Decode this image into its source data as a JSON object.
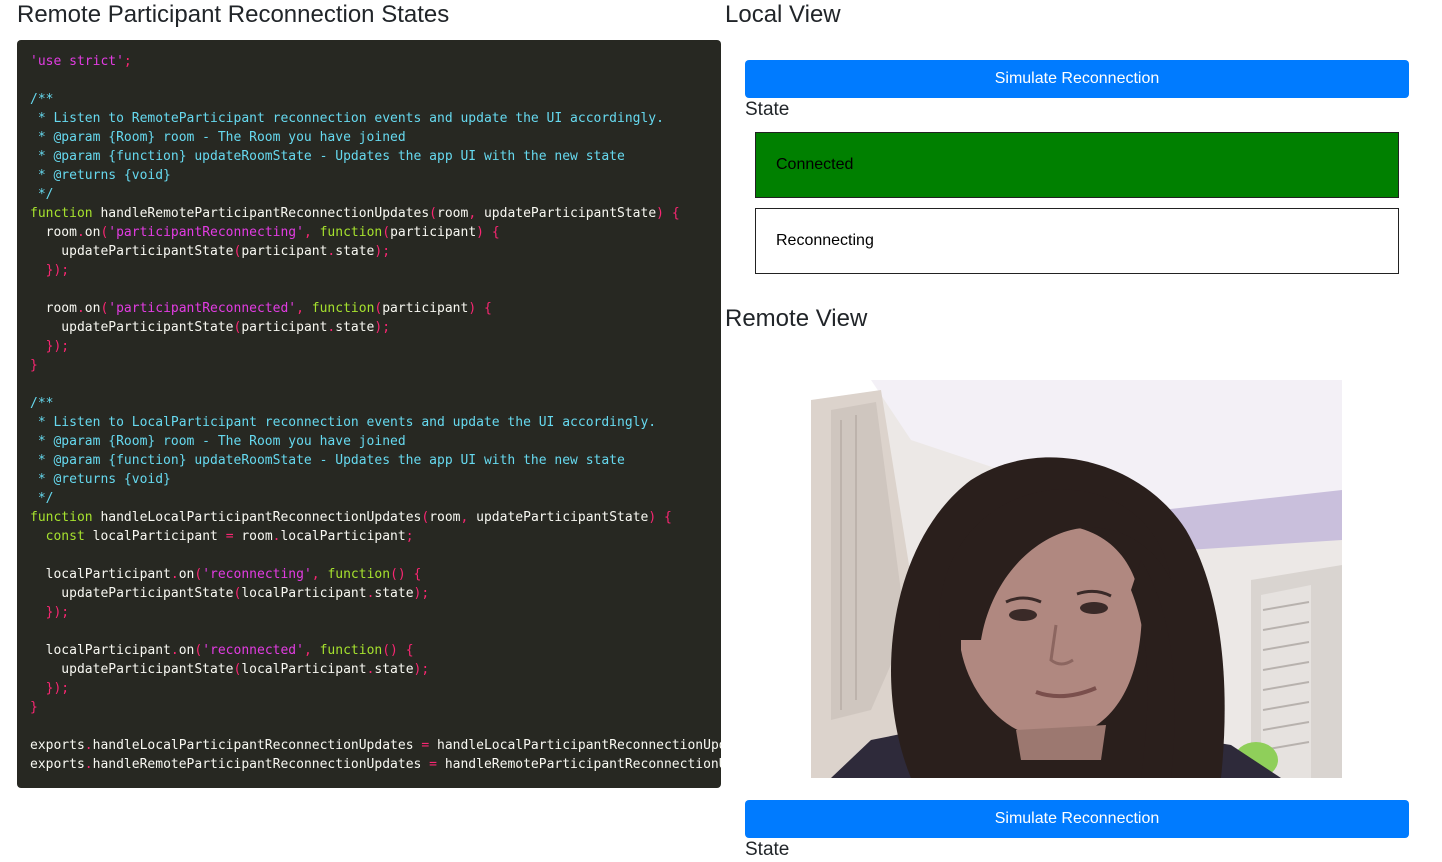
{
  "left_panel": {
    "title": "Remote Participant Reconnection States",
    "code_lines": [
      [
        [
          "s",
          "'use strict'"
        ],
        [
          "p",
          ";"
        ]
      ],
      [],
      [
        [
          "c",
          "/**"
        ]
      ],
      [
        [
          "c",
          " * Listen to RemoteParticipant reconnection events and update the UI accordingly."
        ]
      ],
      [
        [
          "c",
          " * @param {Room} room - The Room you have joined"
        ]
      ],
      [
        [
          "c",
          " * @param {function} updateRoomState - Updates the app UI with the new state"
        ]
      ],
      [
        [
          "c",
          " * @returns {void}"
        ]
      ],
      [
        [
          "c",
          " */"
        ]
      ],
      [
        [
          "k",
          "function"
        ],
        [
          "v",
          " handleRemoteParticipantReconnectionUpdates"
        ],
        [
          "p",
          "("
        ],
        [
          "v",
          "room"
        ],
        [
          "p",
          ","
        ],
        [
          "v",
          " updateParticipantState"
        ],
        [
          "p",
          ")"
        ],
        [
          "v",
          " "
        ],
        [
          "p",
          "{"
        ]
      ],
      [
        [
          "v",
          "  room"
        ],
        [
          "p",
          "."
        ],
        [
          "v",
          "on"
        ],
        [
          "p",
          "("
        ],
        [
          "s",
          "'participantReconnecting'"
        ],
        [
          "p",
          ","
        ],
        [
          "v",
          " "
        ],
        [
          "k",
          "function"
        ],
        [
          "p",
          "("
        ],
        [
          "v",
          "participant"
        ],
        [
          "p",
          ")"
        ],
        [
          "v",
          " "
        ],
        [
          "p",
          "{"
        ]
      ],
      [
        [
          "v",
          "    updateParticipantState"
        ],
        [
          "p",
          "("
        ],
        [
          "v",
          "participant"
        ],
        [
          "p",
          "."
        ],
        [
          "v",
          "state"
        ],
        [
          "p",
          ");"
        ]
      ],
      [
        [
          "p",
          "  });"
        ]
      ],
      [],
      [
        [
          "v",
          "  room"
        ],
        [
          "p",
          "."
        ],
        [
          "v",
          "on"
        ],
        [
          "p",
          "("
        ],
        [
          "s",
          "'participantReconnected'"
        ],
        [
          "p",
          ","
        ],
        [
          "v",
          " "
        ],
        [
          "k",
          "function"
        ],
        [
          "p",
          "("
        ],
        [
          "v",
          "participant"
        ],
        [
          "p",
          ")"
        ],
        [
          "v",
          " "
        ],
        [
          "p",
          "{"
        ]
      ],
      [
        [
          "v",
          "    updateParticipantState"
        ],
        [
          "p",
          "("
        ],
        [
          "v",
          "participant"
        ],
        [
          "p",
          "."
        ],
        [
          "v",
          "state"
        ],
        [
          "p",
          ");"
        ]
      ],
      [
        [
          "p",
          "  });"
        ]
      ],
      [
        [
          "p",
          "}"
        ]
      ],
      [],
      [
        [
          "c",
          "/**"
        ]
      ],
      [
        [
          "c",
          " * Listen to LocalParticipant reconnection events and update the UI accordingly."
        ]
      ],
      [
        [
          "c",
          " * @param {Room} room - The Room you have joined"
        ]
      ],
      [
        [
          "c",
          " * @param {function} updateRoomState - Updates the app UI with the new state"
        ]
      ],
      [
        [
          "c",
          " * @returns {void}"
        ]
      ],
      [
        [
          "c",
          " */"
        ]
      ],
      [
        [
          "k",
          "function"
        ],
        [
          "v",
          " handleLocalParticipantReconnectionUpdates"
        ],
        [
          "p",
          "("
        ],
        [
          "v",
          "room"
        ],
        [
          "p",
          ","
        ],
        [
          "v",
          " updateParticipantState"
        ],
        [
          "p",
          ")"
        ],
        [
          "v",
          " "
        ],
        [
          "p",
          "{"
        ]
      ],
      [
        [
          "k",
          "  const"
        ],
        [
          "v",
          " localParticipant "
        ],
        [
          "p",
          "="
        ],
        [
          "v",
          " room"
        ],
        [
          "p",
          "."
        ],
        [
          "v",
          "localParticipant"
        ],
        [
          "p",
          ";"
        ]
      ],
      [],
      [
        [
          "v",
          "  localParticipant"
        ],
        [
          "p",
          "."
        ],
        [
          "v",
          "on"
        ],
        [
          "p",
          "("
        ],
        [
          "s",
          "'reconnecting'"
        ],
        [
          "p",
          ","
        ],
        [
          "v",
          " "
        ],
        [
          "k",
          "function"
        ],
        [
          "p",
          "()"
        ],
        [
          "v",
          " "
        ],
        [
          "p",
          "{"
        ]
      ],
      [
        [
          "v",
          "    updateParticipantState"
        ],
        [
          "p",
          "("
        ],
        [
          "v",
          "localParticipant"
        ],
        [
          "p",
          "."
        ],
        [
          "v",
          "state"
        ],
        [
          "p",
          ");"
        ]
      ],
      [
        [
          "p",
          "  });"
        ]
      ],
      [],
      [
        [
          "v",
          "  localParticipant"
        ],
        [
          "p",
          "."
        ],
        [
          "v",
          "on"
        ],
        [
          "p",
          "("
        ],
        [
          "s",
          "'reconnected'"
        ],
        [
          "p",
          ","
        ],
        [
          "v",
          " "
        ],
        [
          "k",
          "function"
        ],
        [
          "p",
          "()"
        ],
        [
          "v",
          " "
        ],
        [
          "p",
          "{"
        ]
      ],
      [
        [
          "v",
          "    updateParticipantState"
        ],
        [
          "p",
          "("
        ],
        [
          "v",
          "localParticipant"
        ],
        [
          "p",
          "."
        ],
        [
          "v",
          "state"
        ],
        [
          "p",
          ");"
        ]
      ],
      [
        [
          "p",
          "  });"
        ]
      ],
      [
        [
          "p",
          "}"
        ]
      ],
      [],
      [
        [
          "v",
          "exports"
        ],
        [
          "p",
          "."
        ],
        [
          "v",
          "handleLocalParticipantReconnectionUpdates "
        ],
        [
          "p",
          "="
        ],
        [
          "v",
          " handleLocalParticipantReconnectionUpdates"
        ],
        [
          "p",
          ";"
        ]
      ],
      [
        [
          "v",
          "exports"
        ],
        [
          "p",
          "."
        ],
        [
          "v",
          "handleRemoteParticipantReconnectionUpdates "
        ],
        [
          "p",
          "="
        ],
        [
          "v",
          " handleRemoteParticipantReconnectionUpdates"
        ],
        [
          "p",
          ";"
        ]
      ]
    ]
  },
  "local_view": {
    "title": "Local View",
    "button_label": "Simulate Reconnection",
    "state_label": "State",
    "states": [
      {
        "label": "Connected",
        "color": "#008000"
      },
      {
        "label": "Reconnecting",
        "color": "#ffffff"
      }
    ]
  },
  "remote_view": {
    "title": "Remote View",
    "button_label": "Simulate Reconnection",
    "state_label": "State"
  },
  "colors": {
    "primary_button": "#007bff",
    "code_background": "#272822",
    "connected_state": "#008000"
  }
}
